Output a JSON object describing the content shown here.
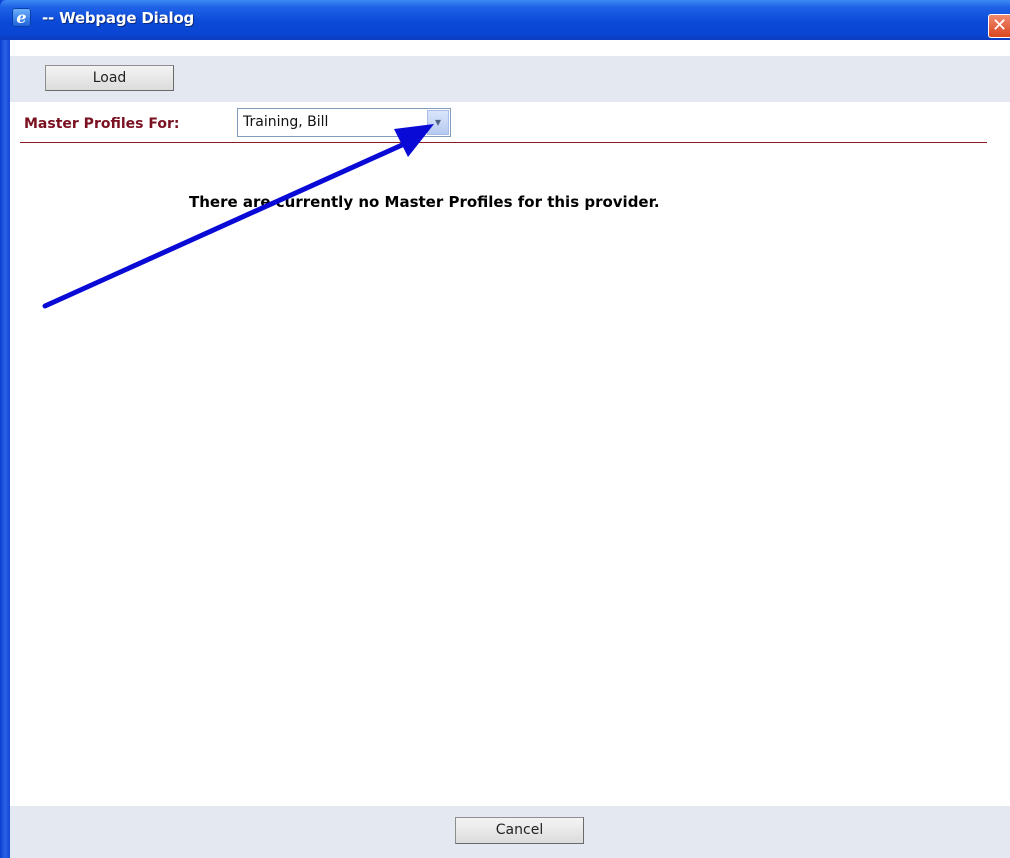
{
  "window": {
    "title": "-- Webpage Dialog",
    "app_icon_glyph": "e",
    "close_glyph": "✕"
  },
  "toolbar": {
    "load_label": "Load"
  },
  "profiles": {
    "label": "Master Profiles For:",
    "provider_value": "Training, Bill",
    "dropdown_glyph": "▾",
    "empty_message": "There are currently no Master Profiles for this provider."
  },
  "footer": {
    "cancel_label": "Cancel"
  },
  "colors": {
    "titlebar": "#0b49d8",
    "label": "#7a1020",
    "separator": "#8a1c22",
    "panel": "#e4e9f1",
    "annotation_arrow": "#0a0ad6"
  },
  "icons": {
    "app": "ie-icon",
    "close": "close-icon",
    "dropdown": "chevron-down-icon",
    "annotation": "arrow-annotation"
  }
}
